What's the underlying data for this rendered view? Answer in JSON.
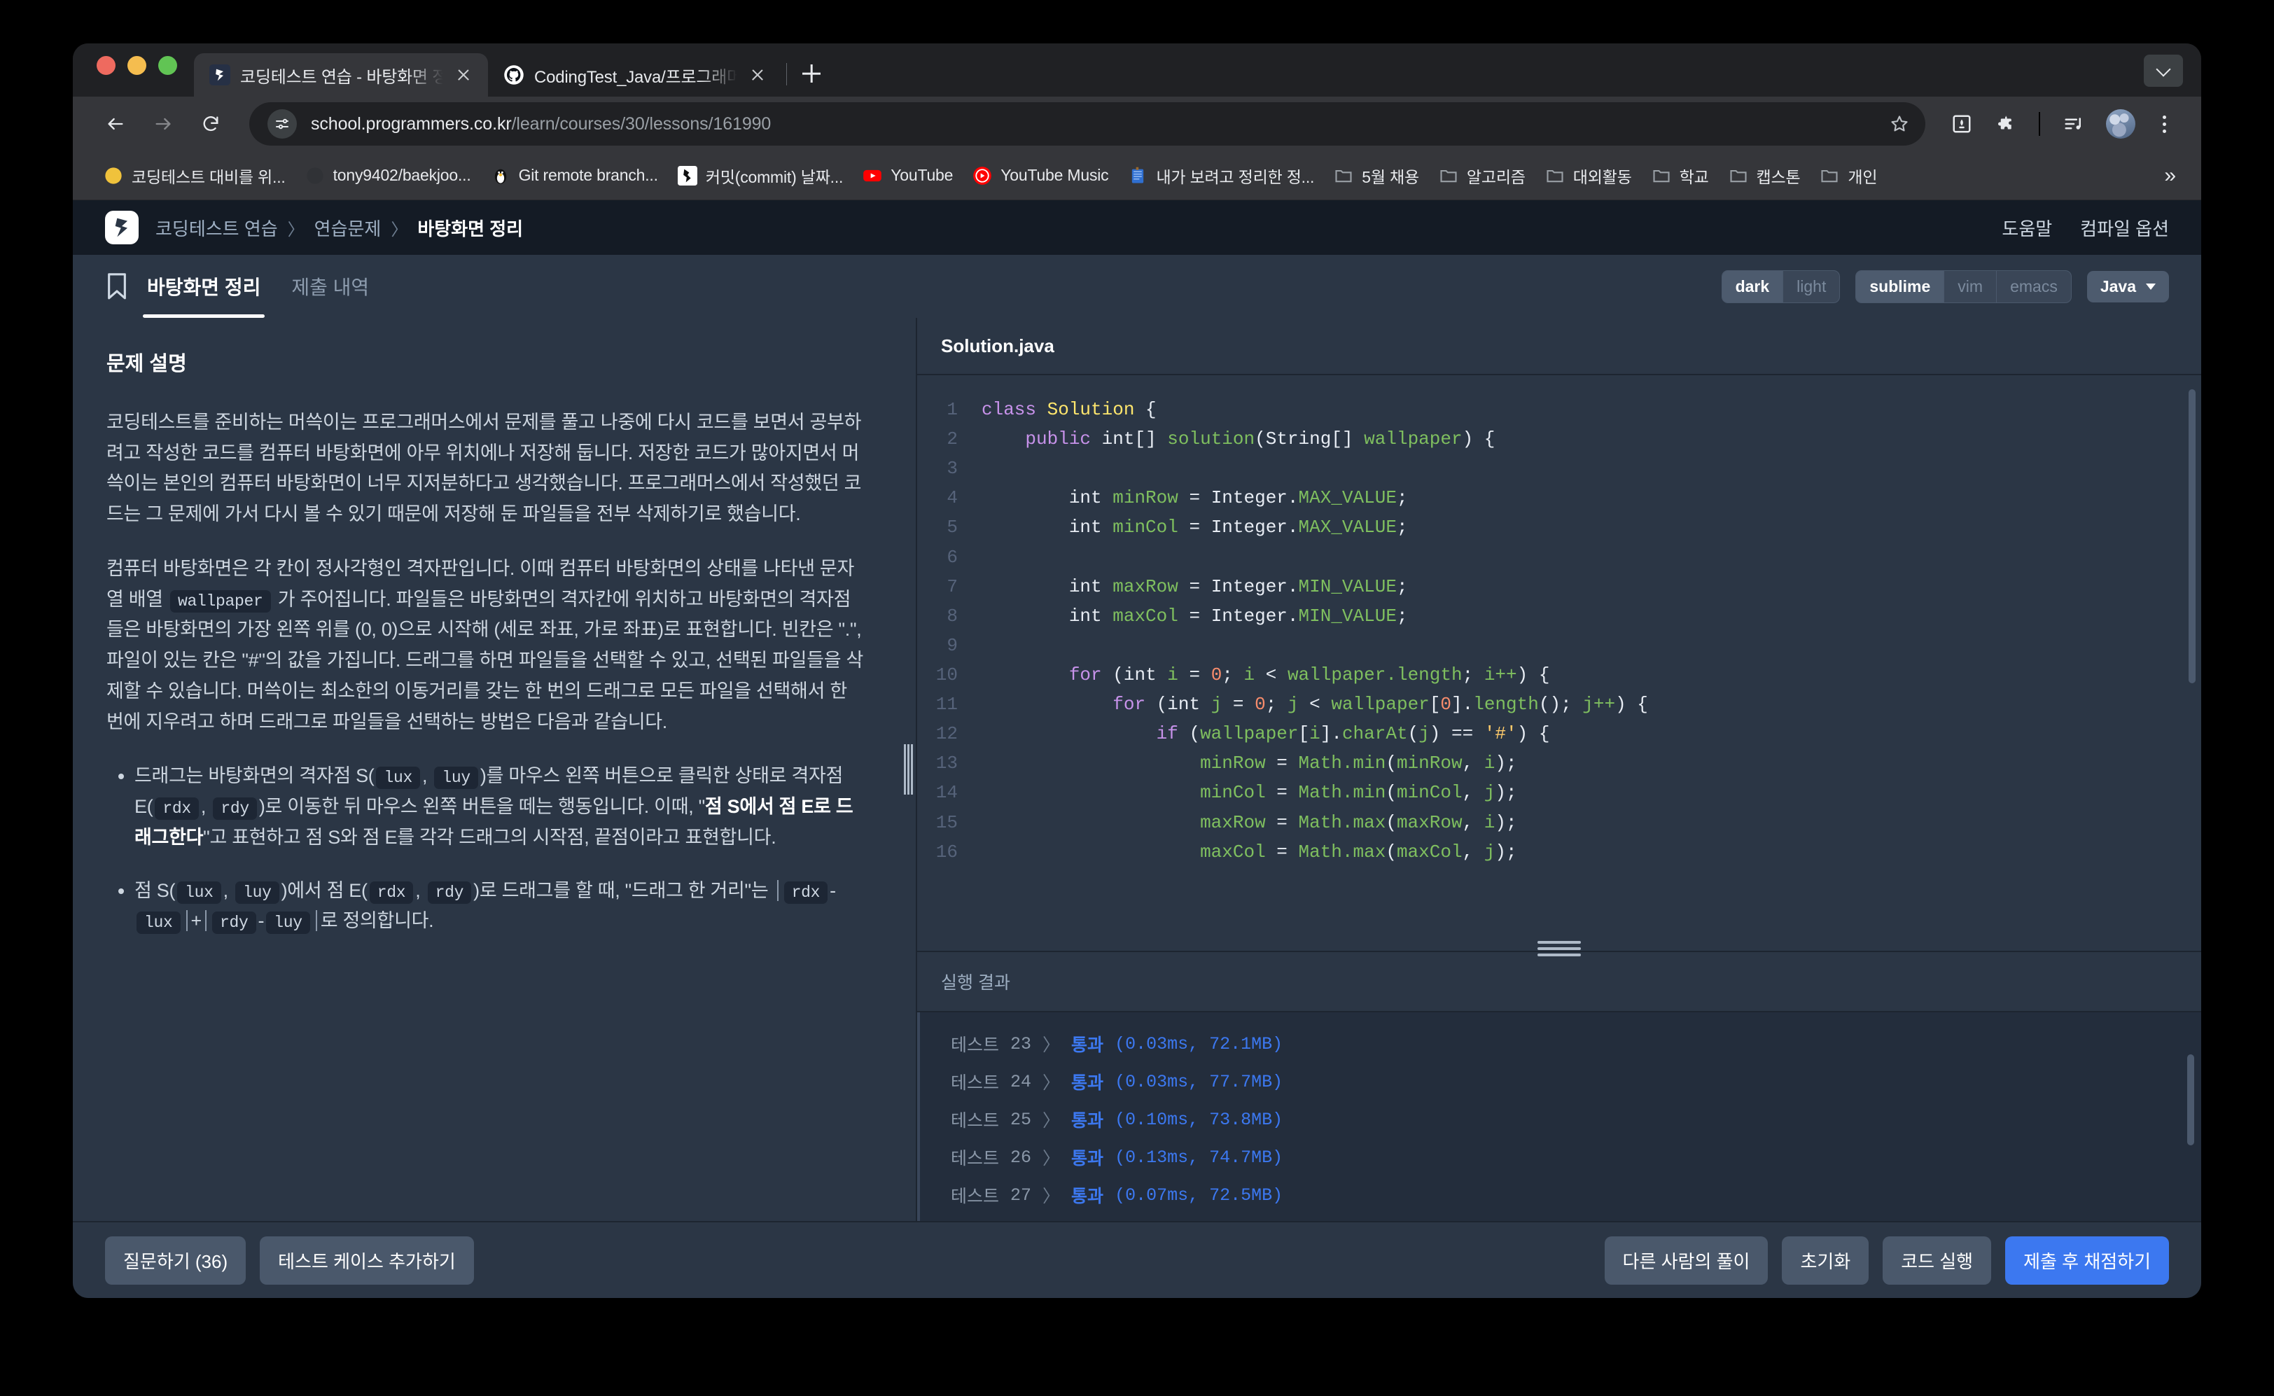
{
  "browser": {
    "tabs": [
      {
        "title": "코딩테스트 연습 - 바탕화면 정리 | ",
        "favicon": "programmers-icon",
        "active": true
      },
      {
        "title": "CodingTest_Java/프로그래머스/",
        "favicon": "github-icon",
        "active": false
      }
    ],
    "new_tab_label": "+",
    "nav": {
      "back": "back-arrow",
      "forward": "forward-arrow",
      "reload": "reload-icon"
    },
    "url": {
      "domain": "school.programmers.co.kr",
      "path": "/learn/courses/30/lessons/161990"
    },
    "bookmarks": [
      {
        "label": "코딩테스트 대비를 위...",
        "icon": "yellow-circle-icon"
      },
      {
        "label": "tony9402/baekjoo...",
        "icon": "github-circle-icon"
      },
      {
        "label": "Git remote branch...",
        "icon": "penguin-icon"
      },
      {
        "label": "커밋(commit) 날짜...",
        "icon": "git-icon"
      },
      {
        "label": "YouTube",
        "icon": "youtube-icon"
      },
      {
        "label": "YouTube Music",
        "icon": "youtube-music-icon"
      },
      {
        "label": "내가 보려고 정리한 정...",
        "icon": "notebook-icon"
      },
      {
        "label": "5월 채용",
        "icon": "folder-icon"
      },
      {
        "label": "알고리즘",
        "icon": "folder-icon"
      },
      {
        "label": "대외활동",
        "icon": "folder-icon"
      },
      {
        "label": "학교",
        "icon": "folder-icon"
      },
      {
        "label": "캡스톤",
        "icon": "folder-icon"
      },
      {
        "label": "개인",
        "icon": "folder-icon"
      }
    ],
    "bookmarks_overflow": "»"
  },
  "site": {
    "breadcrumb": {
      "root": "코딩테스트 연습",
      "middle": "연습문제",
      "current": "바탕화면 정리",
      "separator": "〉"
    },
    "header_links": {
      "help": "도움말",
      "compile_options": "컴파일 옵션"
    }
  },
  "subbar": {
    "tabs": [
      {
        "label": "바탕화면 정리",
        "active": true
      },
      {
        "label": "제출 내역",
        "active": false
      }
    ],
    "theme_toggle": [
      {
        "label": "dark",
        "on": true
      },
      {
        "label": "light",
        "on": false
      }
    ],
    "keymap_toggle": [
      {
        "label": "sublime",
        "on": true
      },
      {
        "label": "vim",
        "on": false
      },
      {
        "label": "emacs",
        "on": false
      }
    ],
    "language": "Java"
  },
  "problem": {
    "title": "문제 설명",
    "para1": "코딩테스트를 준비하는 머쓱이는 프로그래머스에서 문제를 풀고 나중에 다시 코드를 보면서 공부하려고 작성한 코드를 컴퓨터 바탕화면에 아무 위치에나 저장해 둡니다. 저장한 코드가 많아지면서 머쓱이는 본인의 컴퓨터 바탕화면이 너무 지저분하다고 생각했습니다. 프로그래머스에서 작성했던 코드는 그 문제에 가서 다시 볼 수 있기 때문에 저장해 둔 파일들을 전부 삭제하기로 했습니다.",
    "para2_a": "컴퓨터 바탕화면은 각 칸이 정사각형인 격자판입니다. 이때 컴퓨터 바탕화면의 상태를 나타낸 문자열 배열 ",
    "para2_code": "wallpaper",
    "para2_b": " 가 주어집니다. 파일들은 바탕화면의 격자칸에 위치하고 바탕화면의 격자점들은 바탕화면의 가장 왼쪽 위를 (0, 0)으로 시작해 (세로 좌표, 가로 좌표)로 표현합니다. 빈칸은 \".\", 파일이 있는 칸은 \"#\"의 값을 가집니다. 드래그를 하면 파일들을 선택할 수 있고, 선택된 파일들을 삭제할 수 있습니다. 머쓱이는 최소한의 이동거리를 갖는 한 번의 드래그로 모든 파일을 선택해서 한 번에 지우려고 하며 드래그로 파일들을 선택하는 방법은 다음과 같습니다.",
    "bullet1": {
      "a": "드래그는 바탕화면의 격자점 S(",
      "c1": "lux",
      "b": ", ",
      "c2": "luy",
      "c": ")를 마우스 왼쪽 버튼으로 클릭한 상태로 격자점 E(",
      "c3": "rdx",
      "d": ", ",
      "c4": "rdy",
      "e": ")로 이동한 뒤 마우스 왼쪽 버튼을 떼는 행동입니다. 이때, \"",
      "bold1": "점 S에서 점 E로 드래그한다",
      "f": "\"고 표현하고 점 S와 점 E를 각각 드래그의 시작점, 끝점이라고 표현합니다."
    },
    "bullet2": {
      "a": "점 S(",
      "c1": "lux",
      "b": ", ",
      "c2": "luy",
      "c": ")에서 점 E(",
      "c3": "rdx",
      "d": ", ",
      "c4": "rdy",
      "e": ")로 드래그를 할 때, \"드래그 한 거리\"는 ",
      "c5": "rdx",
      "minus1": "-",
      "c6": "lux",
      "plus": "+",
      "c7": "rdy",
      "minus2": "-",
      "c8": "luy",
      "f": "로 정의합니다."
    }
  },
  "editor": {
    "filename": "Solution.java",
    "lines": [
      {
        "n": "1",
        "tokens": [
          [
            "k",
            "class"
          ],
          [
            "p",
            " "
          ],
          [
            "cls",
            "Solution"
          ],
          [
            "p",
            " {"
          ]
        ]
      },
      {
        "n": "2",
        "tokens": [
          [
            "p",
            "    "
          ],
          [
            "k",
            "public"
          ],
          [
            "p",
            " "
          ],
          [
            "p",
            "int"
          ],
          [
            "p",
            "[] "
          ],
          [
            "id",
            "solution"
          ],
          [
            "p",
            "("
          ],
          [
            "p",
            "String"
          ],
          [
            "p",
            "[] "
          ],
          [
            "id",
            "wallpaper"
          ],
          [
            "p",
            ") {"
          ]
        ]
      },
      {
        "n": "3",
        "tokens": [
          [
            "p",
            ""
          ]
        ]
      },
      {
        "n": "4",
        "tokens": [
          [
            "p",
            "        "
          ],
          [
            "p",
            "int"
          ],
          [
            "p",
            " "
          ],
          [
            "id",
            "minRow"
          ],
          [
            "p",
            " = "
          ],
          [
            "p",
            "Integer."
          ],
          [
            "id",
            "MAX_VALUE"
          ],
          [
            "p",
            ";"
          ]
        ]
      },
      {
        "n": "5",
        "tokens": [
          [
            "p",
            "        "
          ],
          [
            "p",
            "int"
          ],
          [
            "p",
            " "
          ],
          [
            "id",
            "minCol"
          ],
          [
            "p",
            " = "
          ],
          [
            "p",
            "Integer."
          ],
          [
            "id",
            "MAX_VALUE"
          ],
          [
            "p",
            ";"
          ]
        ]
      },
      {
        "n": "6",
        "tokens": [
          [
            "p",
            ""
          ]
        ]
      },
      {
        "n": "7",
        "tokens": [
          [
            "p",
            "        "
          ],
          [
            "p",
            "int"
          ],
          [
            "p",
            " "
          ],
          [
            "id",
            "maxRow"
          ],
          [
            "p",
            " = "
          ],
          [
            "p",
            "Integer."
          ],
          [
            "id",
            "MIN_VALUE"
          ],
          [
            "p",
            ";"
          ]
        ]
      },
      {
        "n": "8",
        "tokens": [
          [
            "p",
            "        "
          ],
          [
            "p",
            "int"
          ],
          [
            "p",
            " "
          ],
          [
            "id",
            "maxCol"
          ],
          [
            "p",
            " = "
          ],
          [
            "p",
            "Integer."
          ],
          [
            "id",
            "MIN_VALUE"
          ],
          [
            "p",
            ";"
          ]
        ]
      },
      {
        "n": "9",
        "tokens": [
          [
            "p",
            ""
          ]
        ]
      },
      {
        "n": "10",
        "tokens": [
          [
            "p",
            "        "
          ],
          [
            "k",
            "for"
          ],
          [
            "p",
            " ("
          ],
          [
            "p",
            "int"
          ],
          [
            "p",
            " "
          ],
          [
            "id",
            "i"
          ],
          [
            "p",
            " = "
          ],
          [
            "num",
            "0"
          ],
          [
            "p",
            "; "
          ],
          [
            "id",
            "i"
          ],
          [
            "p",
            " < "
          ],
          [
            "id",
            "wallpaper.length"
          ],
          [
            "p",
            "; "
          ],
          [
            "id",
            "i++"
          ],
          [
            "p",
            ") {"
          ]
        ]
      },
      {
        "n": "11",
        "tokens": [
          [
            "p",
            "            "
          ],
          [
            "k",
            "for"
          ],
          [
            "p",
            " ("
          ],
          [
            "p",
            "int"
          ],
          [
            "p",
            " "
          ],
          [
            "id",
            "j"
          ],
          [
            "p",
            " = "
          ],
          [
            "num",
            "0"
          ],
          [
            "p",
            "; "
          ],
          [
            "id",
            "j"
          ],
          [
            "p",
            " < "
          ],
          [
            "id",
            "wallpaper"
          ],
          [
            "p",
            "["
          ],
          [
            "num",
            "0"
          ],
          [
            "p",
            "]."
          ],
          [
            "id",
            "length"
          ],
          [
            "p",
            "(); "
          ],
          [
            "id",
            "j++"
          ],
          [
            "p",
            ") {"
          ]
        ]
      },
      {
        "n": "12",
        "tokens": [
          [
            "p",
            "                "
          ],
          [
            "k",
            "if"
          ],
          [
            "p",
            " ("
          ],
          [
            "id",
            "wallpaper"
          ],
          [
            "p",
            "["
          ],
          [
            "id",
            "i"
          ],
          [
            "p",
            "]."
          ],
          [
            "id",
            "charAt"
          ],
          [
            "p",
            "("
          ],
          [
            "id",
            "j"
          ],
          [
            "p",
            ") == "
          ],
          [
            "str",
            "'#'"
          ],
          [
            "p",
            ") {"
          ]
        ]
      },
      {
        "n": "13",
        "tokens": [
          [
            "p",
            "                    "
          ],
          [
            "id",
            "minRow"
          ],
          [
            "p",
            " = "
          ],
          [
            "id",
            "Math.min"
          ],
          [
            "p",
            "("
          ],
          [
            "id",
            "minRow"
          ],
          [
            "p",
            ", "
          ],
          [
            "id",
            "i"
          ],
          [
            "p",
            ");"
          ]
        ]
      },
      {
        "n": "14",
        "tokens": [
          [
            "p",
            "                    "
          ],
          [
            "id",
            "minCol"
          ],
          [
            "p",
            " = "
          ],
          [
            "id",
            "Math.min"
          ],
          [
            "p",
            "("
          ],
          [
            "id",
            "minCol"
          ],
          [
            "p",
            ", "
          ],
          [
            "id",
            "j"
          ],
          [
            "p",
            ");"
          ]
        ]
      },
      {
        "n": "15",
        "tokens": [
          [
            "p",
            "                    "
          ],
          [
            "id",
            "maxRow"
          ],
          [
            "p",
            " = "
          ],
          [
            "id",
            "Math.max"
          ],
          [
            "p",
            "("
          ],
          [
            "id",
            "maxRow"
          ],
          [
            "p",
            ", "
          ],
          [
            "id",
            "i"
          ],
          [
            "p",
            ");"
          ]
        ]
      },
      {
        "n": "16",
        "tokens": [
          [
            "p",
            "                    "
          ],
          [
            "id",
            "maxCol"
          ],
          [
            "p",
            " = "
          ],
          [
            "id",
            "Math.max"
          ],
          [
            "p",
            "("
          ],
          [
            "id",
            "maxCol"
          ],
          [
            "p",
            ", "
          ],
          [
            "id",
            "j"
          ],
          [
            "p",
            ");"
          ]
        ]
      }
    ]
  },
  "results": {
    "title": "실행 결과",
    "rows": [
      {
        "label": "테스트",
        "num": "23",
        "chev": "〉",
        "status": "통과",
        "detail": "(0.03ms, 72.1MB)"
      },
      {
        "label": "테스트",
        "num": "24",
        "chev": "〉",
        "status": "통과",
        "detail": "(0.03ms, 77.7MB)"
      },
      {
        "label": "테스트",
        "num": "25",
        "chev": "〉",
        "status": "통과",
        "detail": "(0.10ms, 73.8MB)"
      },
      {
        "label": "테스트",
        "num": "26",
        "chev": "〉",
        "status": "통과",
        "detail": "(0.13ms, 74.7MB)"
      },
      {
        "label": "테스트",
        "num": "27",
        "chev": "〉",
        "status": "통과",
        "detail": "(0.07ms, 72.5MB)"
      }
    ]
  },
  "footer": {
    "ask_question": "질문하기 (36)",
    "add_test_case": "테스트 케이스 추가하기",
    "others_solutions": "다른 사람의 풀이",
    "reset": "초기화",
    "run_code": "코드 실행",
    "submit": "제출 후 채점하기"
  },
  "colors": {
    "accent": "#3c78f0",
    "panel": "#2b3645",
    "page_bg": "#141b25",
    "browser_chrome": "#35363a"
  }
}
